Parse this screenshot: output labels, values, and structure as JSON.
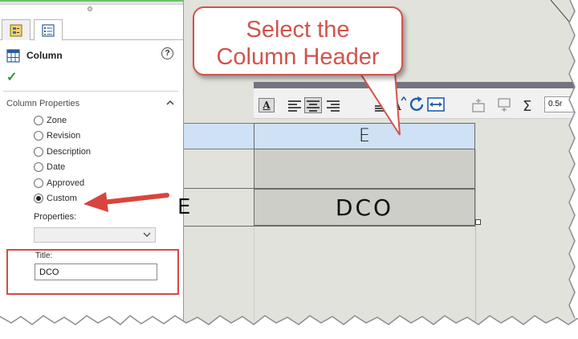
{
  "property_manager": {
    "header_title": "Column",
    "help_glyph": "?",
    "ok_glyph": "✓",
    "section_title": "Column Properties",
    "radio_options": [
      {
        "label": "Zone",
        "selected": false
      },
      {
        "label": "Revision",
        "selected": false
      },
      {
        "label": "Description",
        "selected": false
      },
      {
        "label": "Date",
        "selected": false
      },
      {
        "label": "Approved",
        "selected": false
      },
      {
        "label": "Custom",
        "selected": true
      }
    ],
    "properties_label": "Properties:",
    "properties_value": "",
    "title_label": "Title:",
    "title_value": "DCO"
  },
  "table": {
    "header_cell_text": "E",
    "left_cell_fragment": "E",
    "value_cell_text": "DCO"
  },
  "toolbar": {
    "font_button_label": "A",
    "zoom_value": "0.5r"
  },
  "callout": {
    "line1": "Select the",
    "line2": "Column Header"
  },
  "colors": {
    "highlight_red": "#d2534d",
    "selected_cell_blue": "#cfe1f4",
    "check_green": "#2e9b2e"
  }
}
